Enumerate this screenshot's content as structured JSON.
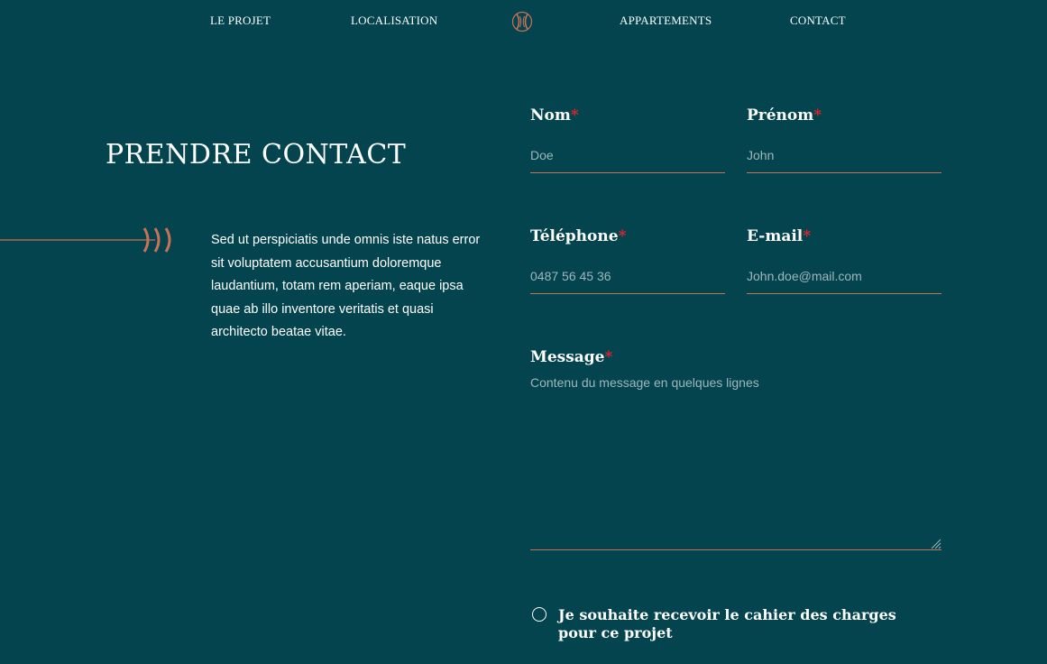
{
  "nav": {
    "items": [
      {
        "label": "LE PROJET"
      },
      {
        "label": "LOCALISATION"
      },
      {
        "label": "APPARTEMENTS"
      },
      {
        "label": "CONTACT"
      }
    ],
    "logo_icon": "brand-logo-icon"
  },
  "contact": {
    "title": "PRENDRE CONTACT",
    "intro": "Sed ut perspiciatis unde omnis iste natus error sit voluptatem accusantium doloremque laudantium, totam rem aperiam, eaque ipsa quae ab illo inventore veritatis et quasi architecto beatae vitae.",
    "decoration_icon": "arrow-chevrons-icon"
  },
  "form": {
    "required_marker": "*",
    "nom": {
      "label": "Nom",
      "placeholder": "Doe",
      "value": ""
    },
    "prenom": {
      "label": "Prénom",
      "placeholder": "John",
      "value": ""
    },
    "telephone": {
      "label": "Téléphone",
      "placeholder": "0487 56 45 36",
      "value": ""
    },
    "email": {
      "label": "E-mail",
      "placeholder": "John.doe@mail.com",
      "value": ""
    },
    "message": {
      "label": "Message",
      "placeholder": "Contenu du message en quelques lignes",
      "value": ""
    },
    "cahier_checkbox": {
      "label": "Je souhaite recevoir le cahier des charges pour ce projet",
      "checked": false
    }
  },
  "colors": {
    "background": "#03444f",
    "accent": "#c87256",
    "required": "#e0242b",
    "text": "#ffffff",
    "placeholder": "#9fb6ba"
  }
}
